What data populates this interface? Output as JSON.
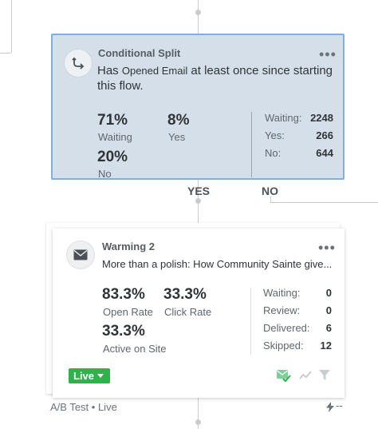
{
  "split": {
    "kind": "Conditional Split",
    "menu": "•••",
    "desc_prefix": "Has",
    "desc_attr": "Opened Email",
    "desc_suffix": "at least once since starting this flow.",
    "pct_waiting": "71%",
    "lbl_waiting": "Waiting",
    "pct_yes": "8%",
    "lbl_yes": "Yes",
    "pct_no": "20%",
    "lbl_no": "No",
    "stats": [
      {
        "label": "Waiting:",
        "value": "2248"
      },
      {
        "label": "Yes:",
        "value": "266"
      },
      {
        "label": "No:",
        "value": "644"
      }
    ]
  },
  "branches": {
    "yes": "YES",
    "no": "NO"
  },
  "email": {
    "name": "Warming 2",
    "menu": "•••",
    "subject": "More than a polish: How Community Sainte give...",
    "open_rate": "83.3%",
    "open_rate_label": "Open Rate",
    "click_rate": "33.3%",
    "click_rate_label": "Click Rate",
    "active": "33.3%",
    "active_label": "Active on Site",
    "stats": [
      {
        "label": "Waiting:",
        "value": "0"
      },
      {
        "label": "Review:",
        "value": "0"
      },
      {
        "label": "Delivered:",
        "value": "6"
      },
      {
        "label": "Skipped:",
        "value": "12"
      }
    ],
    "status": "Live"
  },
  "footer": {
    "ab_test": "A/B Test • Live",
    "right": "--"
  },
  "colors": {
    "split_bg": "#d5dfe9",
    "split_border": "#7fb0e0",
    "live": "#2fb24c"
  },
  "icons": {
    "split": "split-arrow-icon",
    "email": "envelope-icon",
    "footer": "lightning-icon"
  }
}
